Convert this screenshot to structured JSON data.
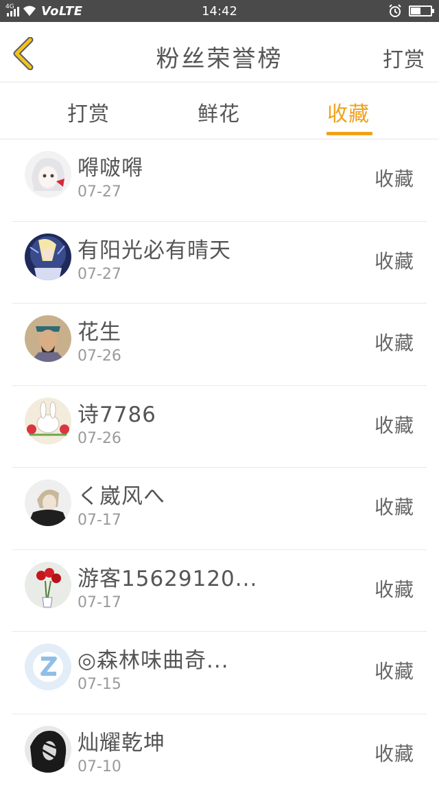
{
  "status_bar": {
    "network_type": "4G",
    "carrier_label": "VoLTE",
    "time": "14:42",
    "battery_level": 0.45
  },
  "header": {
    "title": "粉丝荣誉榜",
    "action_label": "打赏",
    "back_icon": "chevron-left-icon",
    "accent_color": "#f0a11b"
  },
  "tabs": [
    {
      "label": "打赏",
      "active": false
    },
    {
      "label": "鲜花",
      "active": false
    },
    {
      "label": "收藏",
      "active": true
    }
  ],
  "list": [
    {
      "name": "嘚啵嘚",
      "date": "07-27",
      "action": "收藏"
    },
    {
      "name": "有阳光必有晴天",
      "date": "07-27",
      "action": "收藏"
    },
    {
      "name": "花生",
      "date": "07-26",
      "action": "收藏"
    },
    {
      "name": "诗7786",
      "date": "07-26",
      "action": "收藏"
    },
    {
      "name": "く崴风へ",
      "date": "07-17",
      "action": "收藏"
    },
    {
      "name": "游客15629120...",
      "date": "07-17",
      "action": "收藏"
    },
    {
      "name": "◎森林味曲奇...",
      "date": "07-15",
      "action": "收藏"
    },
    {
      "name": "灿耀乾坤",
      "date": "07-10",
      "action": "收藏"
    }
  ]
}
